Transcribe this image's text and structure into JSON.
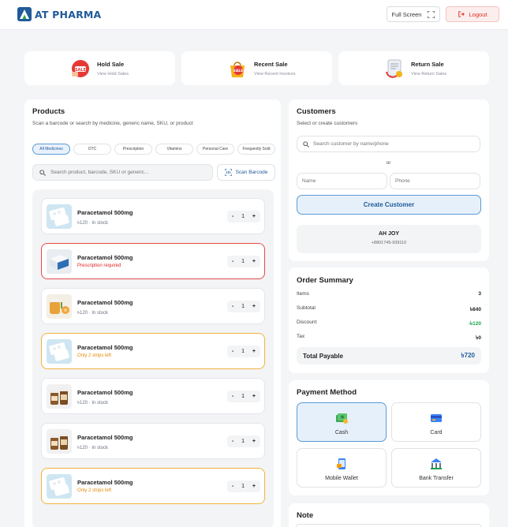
{
  "header": {
    "brand": "AT PHARMA",
    "fullscreen_label": "Full Screen",
    "logout_label": "Logout",
    "brand_color": "#1f5a99",
    "accent_red": "#d92d20"
  },
  "quick_actions": [
    {
      "title": "Hold Sale",
      "subtitle": "View Hold Sales",
      "icon": "hold-sale-icon"
    },
    {
      "title": "Recent Sale",
      "subtitle": "View Recent Invoices",
      "icon": "recent-sale-icon"
    },
    {
      "title": "Return Sale",
      "subtitle": "View Return Sales",
      "icon": "return-sale-icon"
    }
  ],
  "products": {
    "title": "Products",
    "subtitle": "Scan a barcode or search by medicine, generic name, SKU, or product",
    "categories": [
      "All Medicines",
      "OTC",
      "Prescription",
      "Vitamins",
      "Personal Care",
      "Frequently Sold"
    ],
    "active_category": "All Medicines",
    "search_placeholder": "Search product, barcode, SKU or generic...",
    "scan_label": "Scan Barcode",
    "items": [
      {
        "name": "Paracetamol 500mg",
        "meta": "৳120 · In stock",
        "qty": "1",
        "status": "normal",
        "image": "blister-pack"
      },
      {
        "name": "Paracetamol 500mg",
        "meta": "Prescription required",
        "qty": "1",
        "status": "prescription",
        "image": "medicine-box"
      },
      {
        "name": "Paracetamol 500mg",
        "meta": "৳120 · In stock",
        "qty": "1",
        "status": "normal",
        "image": "honey-jar"
      },
      {
        "name": "Paracetamol 500mg",
        "meta": "Only 2 strips left",
        "qty": "1",
        "status": "low",
        "image": "blister-pack"
      },
      {
        "name": "Paracetamol 500mg",
        "meta": "৳120 · In stock",
        "qty": "1",
        "status": "normal",
        "image": "pill-bottles"
      },
      {
        "name": "Paracetamol 500mg",
        "meta": "৳120 · In stock",
        "qty": "1",
        "status": "normal",
        "image": "pill-bottles"
      },
      {
        "name": "Paracetamol 500mg",
        "meta": "Only 2 strips left",
        "qty": "1",
        "status": "low",
        "image": "blister-pack"
      }
    ],
    "minus": "-",
    "plus": "+"
  },
  "customers": {
    "title": "Customers",
    "subtitle": "Select or create customers",
    "search_placeholder": "Search customer by name/phone",
    "or_label": "or",
    "name_placeholder": "Name",
    "phone_placeholder": "Phone",
    "create_label": "Create Customer",
    "selected_name": "AH JOY",
    "selected_phone": "+8801745-939110"
  },
  "order_summary": {
    "title": "Order Summary",
    "rows": [
      {
        "label": "Items",
        "value": "3"
      },
      {
        "label": "Subtotal",
        "value": "৳840"
      },
      {
        "label": "Discount",
        "value": "-৳120"
      },
      {
        "label": "Tax",
        "value": "৳0"
      }
    ],
    "total_label": "Total Payable",
    "total_value": "৳720"
  },
  "payment": {
    "title": "Payment Method",
    "methods": [
      {
        "label": "Cash",
        "icon": "cash-icon",
        "active": true
      },
      {
        "label": "Card",
        "icon": "card-icon",
        "active": false
      },
      {
        "label": "Mobile Wallet",
        "icon": "mobile-wallet-icon",
        "active": false
      },
      {
        "label": "Bank Transfer",
        "icon": "bank-icon",
        "active": false
      }
    ]
  },
  "note": {
    "title": "Note"
  }
}
